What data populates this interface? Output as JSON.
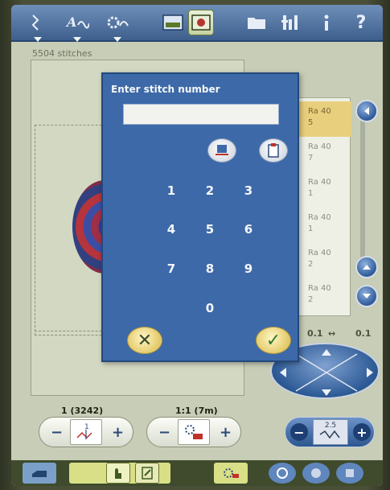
{
  "toolbar": {
    "icons": [
      "stitch-menu-icon",
      "font-menu-icon",
      "design-menu-icon",
      "embroidery-edit-icon",
      "embroidery-stitch-out-icon",
      "file-manager-icon",
      "settings-icon",
      "info-icon",
      "help-icon"
    ],
    "help_label": "?"
  },
  "workspace": {
    "stitch_count": "5504 stitches"
  },
  "color_list": {
    "items": [
      {
        "line1": "Ra 40",
        "line2": "5",
        "selected": true
      },
      {
        "line1": "Ra 40",
        "line2": "7",
        "selected": false
      },
      {
        "line1": "Ra 40",
        "line2": "1",
        "selected": false
      },
      {
        "line1": "Ra 40",
        "line2": "1",
        "selected": false
      },
      {
        "line1": "Ra 40",
        "line2": "2",
        "selected": false
      },
      {
        "line1": "Ra 40",
        "line2": "2",
        "selected": false
      }
    ]
  },
  "zoom": {
    "left": "0.1",
    "separator": "↔",
    "right": "0.1"
  },
  "dialog": {
    "title": "Enter stitch number",
    "input_value": "",
    "keys": [
      "1",
      "2",
      "3",
      "4",
      "5",
      "6",
      "7",
      "8",
      "9",
      "0"
    ],
    "cancel_symbol": "✕",
    "ok_symbol": "✓"
  },
  "stitch_controls": {
    "color_block_label": "1 (3242)",
    "color_position_label": "1:1 (7m)",
    "stitch_button_text": "1",
    "step_value": "2.5",
    "minus": "−",
    "plus": "+"
  },
  "colors": {
    "toolbar_blue": "#3e5f8d",
    "dialog_blue": "#3d69a8",
    "selection_gold": "#e8cf7d",
    "screen_bg": "#c7cdb6"
  }
}
